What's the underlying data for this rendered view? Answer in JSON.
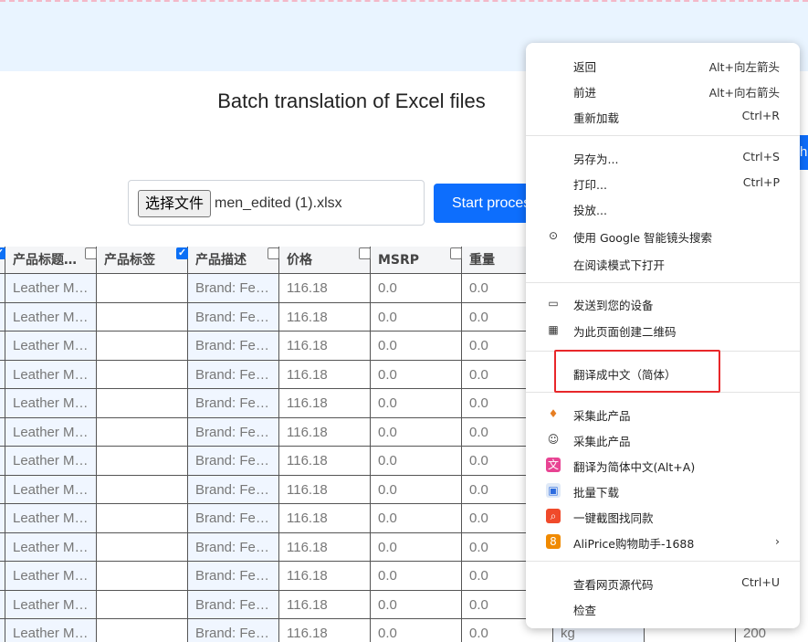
{
  "page": {
    "title": "Batch translation of Excel files",
    "file_button": "选择文件",
    "file_name": "men_edited (1).xlsx",
    "start_button": "Start proces",
    "edge_button_fragment": "h"
  },
  "table": {
    "headers": [
      {
        "label": "产品标题…",
        "checked": true
      },
      {
        "label": "产品标签",
        "checked": false
      },
      {
        "label": "产品描述",
        "checked": true
      },
      {
        "label": "价格",
        "checked": false
      },
      {
        "label": "MSRP",
        "checked": false
      },
      {
        "label": "重量",
        "checked": false
      }
    ],
    "row_values": [
      "Leather M…",
      "",
      "Brand: Fe…",
      "116.18",
      "0.0",
      "0.0"
    ],
    "row_count": 13,
    "partial_row_tail": [
      "kg",
      "",
      "200"
    ]
  },
  "context_menu": {
    "groups": [
      [
        {
          "label": "返回",
          "shortcut": "Alt+向左箭头"
        },
        {
          "label": "前进",
          "shortcut": "Alt+向右箭头"
        },
        {
          "label": "重新加载",
          "shortcut": "Ctrl+R"
        }
      ],
      [
        {
          "label": "另存为...",
          "shortcut": "Ctrl+S"
        },
        {
          "label": "打印...",
          "shortcut": "Ctrl+P"
        },
        {
          "label": "投放...",
          "shortcut": ""
        },
        {
          "label": "使用 Google 智能镜头搜索",
          "shortcut": "",
          "icon": "lens-icon"
        },
        {
          "label": "在阅读模式下打开",
          "shortcut": ""
        }
      ],
      [
        {
          "label": "发送到您的设备",
          "shortcut": "",
          "icon": "device-icon"
        },
        {
          "label": "为此页面创建二维码",
          "shortcut": "",
          "icon": "qr-icon"
        }
      ],
      [
        {
          "label": "翻译成中文（简体）",
          "shortcut": ""
        }
      ],
      [
        {
          "label": "采集此产品",
          "shortcut": "",
          "icon": "carrot-icon"
        },
        {
          "label": "采集此产品",
          "shortcut": "",
          "icon": "robot-icon"
        },
        {
          "label": "翻译为简体中文(Alt+A)",
          "shortcut": "",
          "icon": "translate-icon"
        },
        {
          "label": "批量下载",
          "shortcut": "",
          "icon": "image-download-icon"
        },
        {
          "label": "一键截图找同款",
          "shortcut": "",
          "icon": "screenshot-search-icon"
        },
        {
          "label": "AliPrice购物助手-1688",
          "shortcut": "›",
          "icon": "aliprice-icon"
        }
      ],
      [
        {
          "label": "查看网页源代码",
          "shortcut": "Ctrl+U"
        },
        {
          "label": "检查",
          "shortcut": ""
        }
      ]
    ]
  },
  "colors": {
    "accent": "#0d6efd",
    "highlight_box": "#e8272a",
    "banner": "#e9f4ff"
  }
}
